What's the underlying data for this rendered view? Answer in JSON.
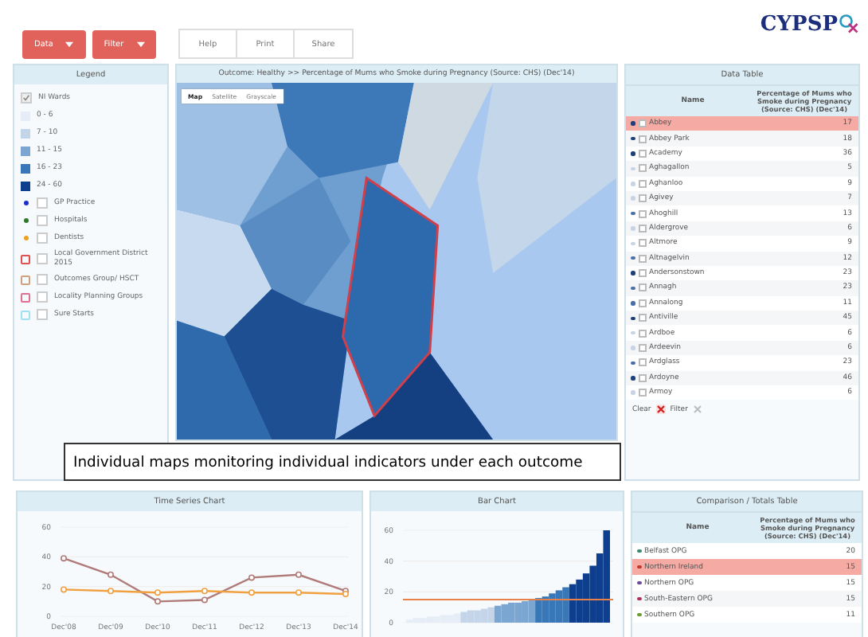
{
  "toolbar": {
    "menus": [
      {
        "label": "Data"
      },
      {
        "label": "Filter"
      }
    ],
    "actions": [
      "Help",
      "Print",
      "Share"
    ]
  },
  "logo": {
    "text": "CYPSP"
  },
  "legend": {
    "title": "Legend",
    "items": [
      {
        "kind": "checkbox",
        "label": "NI Wards",
        "checked": true
      },
      {
        "kind": "swatch",
        "label": "0 - 6",
        "color": "#e6edf6"
      },
      {
        "kind": "swatch",
        "label": "7 - 10",
        "color": "#c4d5ea"
      },
      {
        "kind": "swatch",
        "label": "11 - 15",
        "color": "#7ba6d2"
      },
      {
        "kind": "swatch",
        "label": "16 - 23",
        "color": "#3877b8"
      },
      {
        "kind": "swatch",
        "label": "24 - 60",
        "color": "#0d3f8e"
      },
      {
        "kind": "marker",
        "label": "GP Practice",
        "color": "#1a2fd0",
        "checked": false
      },
      {
        "kind": "marker",
        "label": "Hospitals",
        "color": "#2a7a2a",
        "checked": false
      },
      {
        "kind": "marker",
        "label": "Dentists",
        "color": "#f0a020",
        "checked": false
      },
      {
        "kind": "outline",
        "label": "Local Government District 2015",
        "color": "#e05050",
        "checked": false
      },
      {
        "kind": "outline",
        "label": "Outcomes Group/ HSCT",
        "color": "#d0a080",
        "checked": false
      },
      {
        "kind": "outline",
        "label": "Locality Planning Groups",
        "color": "#e07090",
        "checked": false
      },
      {
        "kind": "outline",
        "label": "Sure Starts",
        "color": "#a0e0f0",
        "checked": false
      }
    ]
  },
  "map": {
    "title": "Outcome: Healthy >> Percentage of Mums who Smoke during Pregnancy (Source: CHS) (Dec'14)",
    "map_types": [
      {
        "label": "Map",
        "selected": true
      },
      {
        "label": "Satellite",
        "selected": false
      },
      {
        "label": "Grayscale",
        "selected": false
      }
    ]
  },
  "data_table": {
    "title": "Data Table",
    "columns": [
      "Name",
      "Percentage of Mums who Smoke during Pregnancy (Source: CHS) (Dec'14)"
    ],
    "rows": [
      {
        "name": "Abbey",
        "value": "17",
        "selected": true,
        "checked": false,
        "color": "#1d3f7a"
      },
      {
        "name": "Abbey Park",
        "value": "18",
        "selected": false,
        "checked": false,
        "color": "#1d3f7a"
      },
      {
        "name": "Academy",
        "value": "36",
        "selected": false,
        "checked": false,
        "color": "#1d3f7a"
      },
      {
        "name": "Aghagallon",
        "value": "5",
        "selected": false,
        "checked": false,
        "color": "#c8d4e4"
      },
      {
        "name": "Aghanloo",
        "value": "9",
        "selected": false,
        "checked": false,
        "color": "#c8d4e4"
      },
      {
        "name": "Agivey",
        "value": "7",
        "selected": false,
        "checked": false,
        "color": "#c8d4e4"
      },
      {
        "name": "Ahoghill",
        "value": "13",
        "selected": false,
        "checked": false,
        "color": "#4a6fa8"
      },
      {
        "name": "Aldergrove",
        "value": "6",
        "selected": false,
        "checked": false,
        "color": "#c8d4e4"
      },
      {
        "name": "Altmore",
        "value": "9",
        "selected": false,
        "checked": false,
        "color": "#c8d4e4"
      },
      {
        "name": "Altnagelvin",
        "value": "12",
        "selected": false,
        "checked": false,
        "color": "#4a6fa8"
      },
      {
        "name": "Andersonstown",
        "value": "23",
        "selected": false,
        "checked": false,
        "color": "#1d3f7a"
      },
      {
        "name": "Annagh",
        "value": "23",
        "selected": false,
        "checked": false,
        "color": "#4a6fa8"
      },
      {
        "name": "Annalong",
        "value": "11",
        "selected": false,
        "checked": false,
        "color": "#4a6fa8"
      },
      {
        "name": "Antiville",
        "value": "45",
        "selected": false,
        "checked": false,
        "color": "#1d3f7a"
      },
      {
        "name": "Ardboe",
        "value": "6",
        "selected": false,
        "checked": false,
        "color": "#c8d4e4"
      },
      {
        "name": "Ardeevin",
        "value": "6",
        "selected": false,
        "checked": false,
        "color": "#c8d4e4"
      },
      {
        "name": "Ardglass",
        "value": "23",
        "selected": false,
        "checked": false,
        "color": "#4a6fa8"
      },
      {
        "name": "Ardoyne",
        "value": "46",
        "selected": false,
        "checked": false,
        "color": "#1d3f7a"
      },
      {
        "name": "Armoy",
        "value": "6",
        "selected": false,
        "checked": false,
        "color": "#c8d4e4"
      }
    ],
    "footer": [
      "Clear",
      "Filter"
    ]
  },
  "caption": "Individual maps monitoring individual indicators under each outcome",
  "time_series": {
    "title": "Time Series Chart",
    "chart_data": {
      "type": "line",
      "categories": [
        "Dec'08",
        "Dec'09",
        "Dec'10",
        "Dec'11",
        "Dec'12",
        "Dec'13",
        "Dec'14"
      ],
      "series": [
        {
          "color": "#b07a78",
          "marker": "circle",
          "values": [
            39,
            28,
            10,
            11,
            26,
            28,
            17
          ]
        },
        {
          "color": "#f0a040",
          "marker": "circle",
          "values": [
            18,
            17,
            16,
            17,
            16,
            16,
            15
          ]
        }
      ],
      "ylim": [
        0,
        60
      ],
      "yticks": [
        0,
        20,
        40,
        60
      ]
    }
  },
  "bar_chart": {
    "title": "Bar Chart",
    "chart_data": {
      "type": "bar",
      "stacked": true,
      "ylim": [
        0,
        60
      ],
      "yticks": [
        0,
        20,
        40,
        60
      ],
      "series": [
        {
          "color": "#e6edf6",
          "values": [
            2,
            3,
            3,
            4,
            4,
            5,
            5,
            6,
            null,
            null,
            null,
            null,
            null,
            null,
            null,
            null,
            null,
            null,
            null,
            null,
            null,
            null,
            null,
            null,
            null,
            null,
            null,
            null,
            null,
            null
          ]
        },
        {
          "color": "#c4d5ea",
          "values": [
            null,
            null,
            null,
            null,
            null,
            null,
            null,
            null,
            7,
            8,
            8,
            9,
            10,
            null,
            null,
            null,
            null,
            null,
            null,
            null,
            null,
            null,
            null,
            null,
            null,
            null,
            null,
            null,
            null,
            null
          ]
        },
        {
          "color": "#7ba6d2",
          "values": [
            null,
            null,
            null,
            null,
            null,
            null,
            null,
            null,
            null,
            null,
            null,
            null,
            null,
            11,
            12,
            13,
            13,
            14,
            15,
            null,
            null,
            null,
            null,
            null,
            null,
            null,
            null,
            null,
            null,
            null
          ]
        },
        {
          "color": "#3877b8",
          "values": [
            null,
            null,
            null,
            null,
            null,
            null,
            null,
            null,
            null,
            null,
            null,
            null,
            null,
            null,
            null,
            null,
            null,
            null,
            null,
            16,
            17,
            19,
            21,
            23,
            null,
            null,
            null,
            null,
            null,
            null
          ]
        },
        {
          "color": "#0d3f8e",
          "values": [
            null,
            null,
            null,
            null,
            null,
            null,
            null,
            null,
            null,
            null,
            null,
            null,
            null,
            null,
            null,
            null,
            null,
            null,
            null,
            null,
            null,
            null,
            null,
            null,
            25,
            28,
            32,
            37,
            45,
            60
          ]
        }
      ],
      "ref_lines": [
        {
          "axis": "y",
          "value": 15,
          "color": "#e8804a"
        }
      ]
    }
  },
  "comparison": {
    "title": "Comparison / Totals Table",
    "columns": [
      "Name",
      "Percentage of Mums who Smoke during Pregnancy (Source: CHS) (Dec'14)"
    ],
    "rows": [
      {
        "name": "Belfast OPG",
        "value": "20",
        "selected": false,
        "color": "#3a8a6a"
      },
      {
        "name": "Northern Ireland",
        "value": "15",
        "selected": true,
        "color": "#c0392b"
      },
      {
        "name": "Northern OPG",
        "value": "15",
        "selected": false,
        "color": "#6b4a9a"
      },
      {
        "name": "South-Eastern OPG",
        "value": "15",
        "selected": false,
        "color": "#b0305a"
      },
      {
        "name": "Southern OPG",
        "value": "11",
        "selected": false,
        "color": "#6a9a30"
      }
    ]
  }
}
